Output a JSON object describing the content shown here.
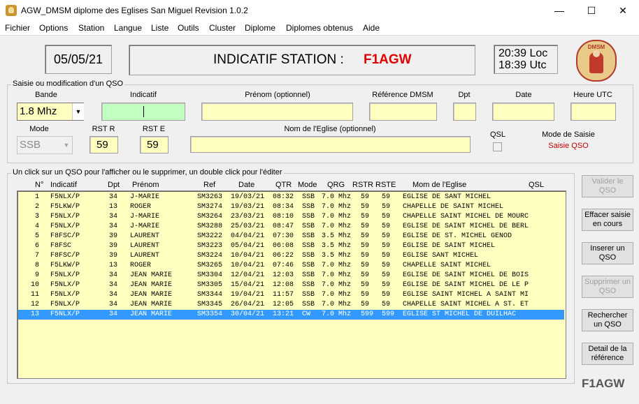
{
  "window": {
    "title": "AGW_DMSM diplome des Eglises San Miguel  Revision  1.0.2",
    "minimize": "—",
    "maximize": "☐",
    "close": "✕"
  },
  "menu": [
    "Fichier",
    "Options",
    "Station",
    "Langue",
    "Liste",
    "Outils",
    "Cluster",
    "Diplome",
    "Diplomes obtenus",
    "Aide"
  ],
  "header": {
    "date": "05/05/21",
    "station_label": "INDICATIF STATION :",
    "station_call": "F1AGW",
    "time_loc": "20:39 Loc",
    "time_utc": "18:39 Utc",
    "logo_text": "DMSM"
  },
  "entry": {
    "group_title": "Saisie ou modification d'un QSO",
    "labels": {
      "bande": "Bande",
      "indicatif": "Indicatif",
      "prenom": "Prénom (optionnel)",
      "reference": "Référence DMSM",
      "dpt": "Dpt",
      "date": "Date",
      "heure": "Heure UTC",
      "mode": "Mode",
      "rst_r": "RST R",
      "rst_e": "RST E",
      "nom_eglise": "Nom de l'Eglise (optionnel)",
      "qsl": "QSL",
      "mode_saisie": "Mode de Saisie"
    },
    "bande_value": "1.8 Mhz",
    "mode_value": "SSB",
    "rst_r_value": "59",
    "rst_e_value": "59",
    "mode_saisie_value": "Saisie QSO"
  },
  "list": {
    "group_title": "Un click sur un QSO pour l'afficher ou le supprimer, un double click pour l'éditer",
    "columns": [
      "N°",
      "Indicatif",
      "Dpt",
      "Prénom",
      "Ref",
      "Date",
      "QTR",
      "Mode",
      "QRG",
      "RSTR",
      "RSTE",
      "Mom de l'Eglise",
      "QSL"
    ],
    "rows": [
      [
        "1",
        "F5NLX/P",
        "34",
        "J-MARIE",
        "SM3263",
        "19/03/21",
        "08:32",
        "SSB",
        "7.0 Mhz",
        "59",
        "59",
        "EGLISE DE SANT MICHEL",
        ""
      ],
      [
        "2",
        "F5LKW/P",
        "13",
        "ROGER",
        "SM3274",
        "19/03/21",
        "08:34",
        "SSB",
        "7.0 Mhz",
        "59",
        "59",
        "CHAPELLE DE SAINT MICHEL",
        ""
      ],
      [
        "3",
        "F5NLX/P",
        "34",
        "J-MARIE",
        "SM3264",
        "23/03/21",
        "08:10",
        "SSB",
        "7.0 Mhz",
        "59",
        "59",
        "CHAPELLE SAINT MICHEL DE MOURC",
        ""
      ],
      [
        "4",
        "F5NLX/P",
        "34",
        "J-MARIE",
        "SM3288",
        "25/03/21",
        "08:47",
        "SSB",
        "7.0 Mhz",
        "59",
        "59",
        "EGLISE DE SAINT MICHEL DE BERL",
        ""
      ],
      [
        "5",
        "F8FSC/P",
        "39",
        "LAURENT",
        "SM3222",
        "04/04/21",
        "07:30",
        "SSB",
        "3.5 Mhz",
        "59",
        "59",
        "EGLISE DE ST. MICHEL GENOD",
        ""
      ],
      [
        "6",
        "F8FSC",
        "39",
        "LAURENT",
        "SM3223",
        "05/04/21",
        "06:08",
        "SSB",
        "3.5 Mhz",
        "59",
        "59",
        "EGLISE DE SAINT MICHEL",
        ""
      ],
      [
        "7",
        "F8FSC/P",
        "39",
        "LAURENT",
        "SM3224",
        "10/04/21",
        "06:22",
        "SSB",
        "3.5 Mhz",
        "59",
        "59",
        "EGLISE SANT MICHEL",
        ""
      ],
      [
        "8",
        "F5LKW/P",
        "13",
        "ROGER",
        "SM3265",
        "10/04/21",
        "07:46",
        "SSB",
        "7.0 Mhz",
        "59",
        "59",
        "CHAPELLE SAINT MICHEL",
        ""
      ],
      [
        "9",
        "F5NLX/P",
        "34",
        "JEAN MARIE",
        "SM3304",
        "12/04/21",
        "12:03",
        "SSB",
        "7.0 Mhz",
        "59",
        "59",
        "EGLISE DE SAINT MICHEL DE BOIS",
        ""
      ],
      [
        "10",
        "F5NLX/P",
        "34",
        "JEAN MARIE",
        "SM3305",
        "15/04/21",
        "12:08",
        "SSB",
        "7.0 Mhz",
        "59",
        "59",
        "EGLISE DE SAINT MICHEL DE LE P",
        ""
      ],
      [
        "11",
        "F5NLX/P",
        "34",
        "JEAN MARIE",
        "SM3344",
        "19/04/21",
        "11:57",
        "SSB",
        "7.0 Mhz",
        "59",
        "59",
        "EGLISE SAINT MICHEL A SAINT MI",
        ""
      ],
      [
        "12",
        "F5NLX/P",
        "34",
        "JEAN MARIE",
        "SM3345",
        "26/04/21",
        "12:05",
        "SSB",
        "7.0 Mhz",
        "59",
        "59",
        "CHAPELLE SAINT MICHEL A ST. ET",
        ""
      ],
      [
        "13",
        "F5NLX/P",
        "34",
        "JEAN MARIE",
        "SM3354",
        "30/04/21",
        "13:21",
        "CW",
        "7.0 Mhz",
        "599",
        "599",
        "EGLISE ST MICHEL DE DUILHAC",
        ""
      ]
    ],
    "selected_index": 12
  },
  "buttons": {
    "valider": "Valider le QSO",
    "effacer": "Effacer saisie en cours",
    "inserer": "Inserer un QSO",
    "supprimer": "Supprimer un QSO",
    "rechercher": "Rechercher un QSO",
    "detail": "Detail de la référence"
  },
  "footer_call": "F1AGW",
  "colors": {
    "field_yellow": "#ffffc0",
    "active_green": "#c0ffc0",
    "call_red": "#e00000",
    "selection_blue": "#3399ff"
  }
}
